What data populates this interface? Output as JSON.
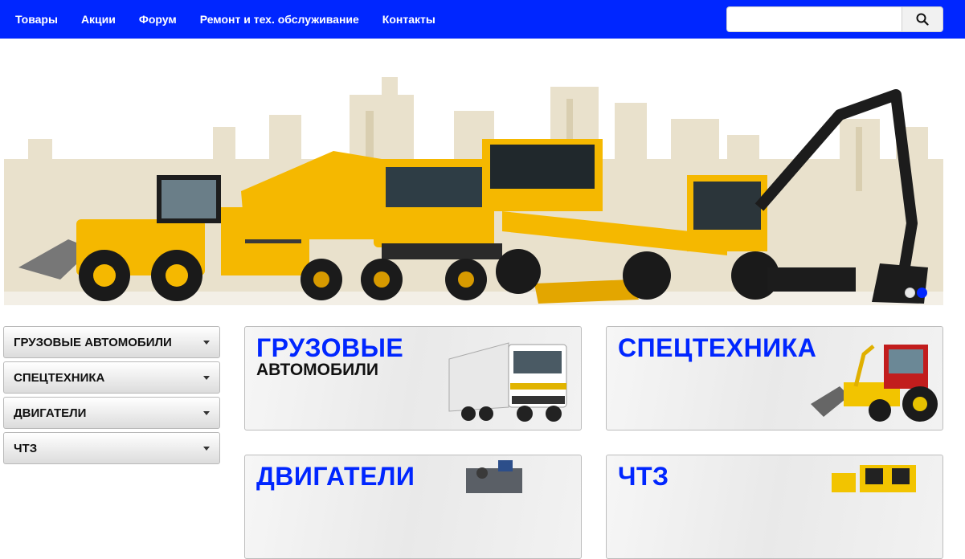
{
  "nav": {
    "items": [
      "Товары",
      "Акции",
      "Форум",
      "Ремонт и тех. обслуживание",
      "Контакты"
    ]
  },
  "search": {
    "placeholder": "",
    "icon": "search-icon"
  },
  "banner": {
    "slides_total": 2,
    "active_slide": 2
  },
  "sidebar": {
    "items": [
      {
        "label": "Грузовые автомобили"
      },
      {
        "label": "Спецтехника"
      },
      {
        "label": "Двигатели"
      },
      {
        "label": "ЧТЗ"
      }
    ]
  },
  "cards": [
    {
      "title": "Грузовые",
      "subtitle": "автомобили"
    },
    {
      "title": "Спецтехника",
      "subtitle": ""
    },
    {
      "title": "Двигатели",
      "subtitle": ""
    },
    {
      "title": "ЧТЗ",
      "subtitle": ""
    }
  ],
  "colors": {
    "brand": "#0026ff",
    "machine_yellow": "#f5b800"
  }
}
